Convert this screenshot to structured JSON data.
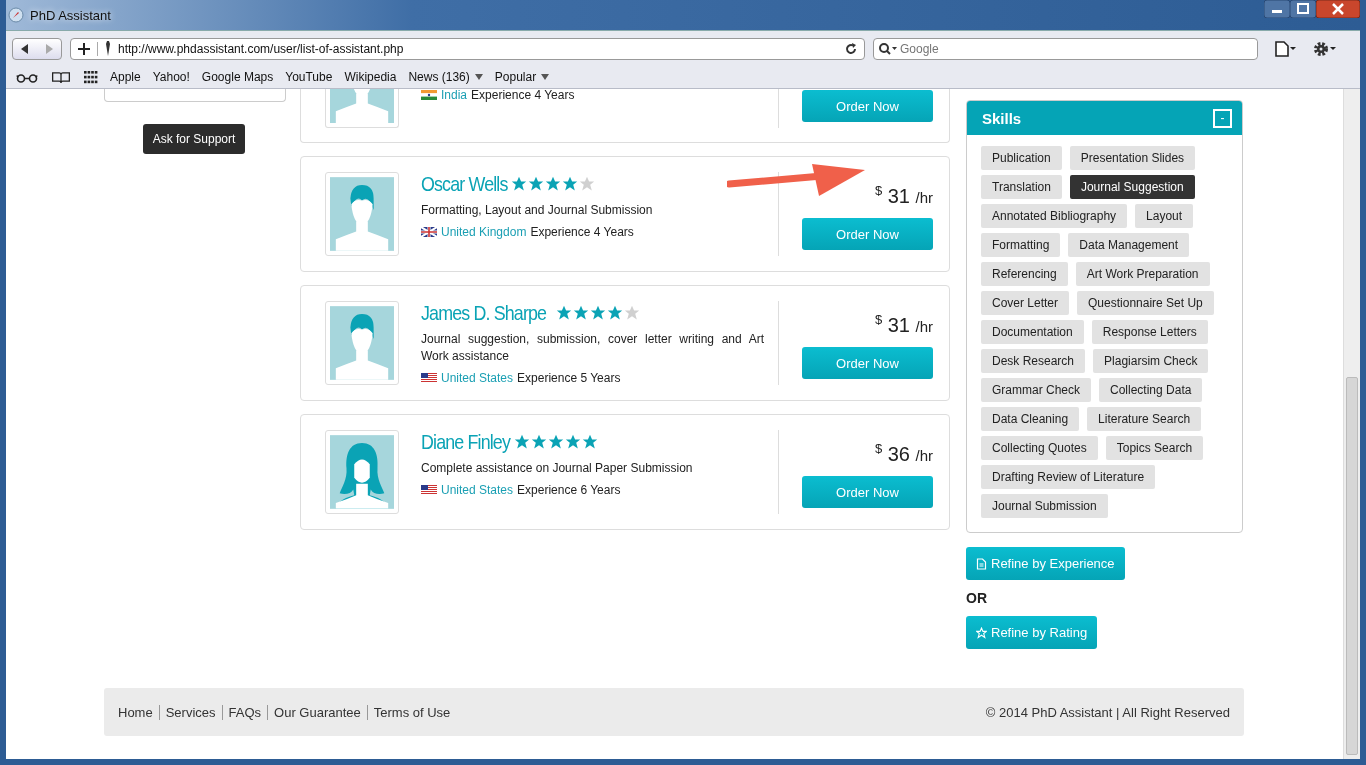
{
  "window": {
    "title": "PhD Assistant"
  },
  "toolbar": {
    "url": "http://www.phdassistant.com/user/list-of-assistant.php",
    "search_placeholder": "Google"
  },
  "bookmarks": [
    {
      "label": "Apple",
      "menu": false
    },
    {
      "label": "Yahoo!",
      "menu": false
    },
    {
      "label": "Google Maps",
      "menu": false
    },
    {
      "label": "YouTube",
      "menu": false
    },
    {
      "label": "Wikipedia",
      "menu": false
    },
    {
      "label": "News (136)",
      "menu": true
    },
    {
      "label": "Popular",
      "menu": true
    }
  ],
  "support_button": "Ask for Support",
  "assistants": [
    {
      "avatar": {
        "kind": "male"
      },
      "flag": {
        "kind": "in"
      },
      "country": "India",
      "experience": "Experience 4 Years",
      "button": "Order Now"
    },
    {
      "avatar": {
        "kind": "male"
      },
      "name": "Oscar Wells",
      "stars": 4,
      "description": "Formatting, Layout and Journal Submission",
      "flag": {
        "kind": "gb"
      },
      "country": "United Kingdom",
      "experience": "Experience 4 Years",
      "currency": "$",
      "price": "31",
      "unit": "/hr",
      "button": "Order Now"
    },
    {
      "avatar": {
        "kind": "male"
      },
      "name": "James D. Sharpe",
      "stars": 4,
      "description": "Journal suggestion, submission, cover letter writing and Art Work assistance",
      "flag": {
        "kind": "us"
      },
      "country": "United States",
      "experience": "Experience 5 Years",
      "currency": "$",
      "price": "31",
      "unit": "/hr",
      "button": "Order Now"
    },
    {
      "avatar": {
        "kind": "female"
      },
      "name": "Diane Finley",
      "stars": 5,
      "description": "Complete assistance on Journal Paper Submission",
      "flag": {
        "kind": "us"
      },
      "country": "United States",
      "experience": "Experience 6 Years",
      "currency": "$",
      "price": "36",
      "unit": "/hr",
      "button": "Order Now"
    }
  ],
  "skills": {
    "title": "Skills",
    "collapse": "-",
    "tags": [
      {
        "label": "Publication",
        "selected": false
      },
      {
        "label": "Presentation Slides",
        "selected": false
      },
      {
        "label": "Translation",
        "selected": false
      },
      {
        "label": "Journal Suggestion",
        "selected": true
      },
      {
        "label": "Annotated Bibliography",
        "selected": false
      },
      {
        "label": "Layout",
        "selected": false
      },
      {
        "label": "Formatting",
        "selected": false
      },
      {
        "label": "Data Management",
        "selected": false
      },
      {
        "label": "Referencing",
        "selected": false
      },
      {
        "label": "Art Work Preparation",
        "selected": false
      },
      {
        "label": "Cover Letter",
        "selected": false
      },
      {
        "label": "Questionnaire Set Up",
        "selected": false
      },
      {
        "label": "Documentation",
        "selected": false
      },
      {
        "label": "Response Letters",
        "selected": false
      },
      {
        "label": "Desk Research",
        "selected": false
      },
      {
        "label": "Plagiarsim Check",
        "selected": false
      },
      {
        "label": "Grammar Check",
        "selected": false
      },
      {
        "label": "Collecting Data",
        "selected": false
      },
      {
        "label": "Data Cleaning",
        "selected": false
      },
      {
        "label": "Literature Search",
        "selected": false
      },
      {
        "label": "Collecting Quotes",
        "selected": false
      },
      {
        "label": "Topics Search",
        "selected": false
      },
      {
        "label": "Drafting Review of Literature",
        "selected": false
      },
      {
        "label": "Journal Submission",
        "selected": false
      }
    ]
  },
  "refine": [
    {
      "kind": "experience",
      "label": "Refine by Experience"
    },
    {
      "kind": "rating",
      "label": "Refine by Rating"
    }
  ],
  "or_label": "OR",
  "footer": {
    "links": [
      "Home",
      "Services",
      "FAQs",
      "Our Guarantee",
      "Terms of Use"
    ],
    "copyright": "© 2014 PhD Assistant | All Right Reserved"
  }
}
